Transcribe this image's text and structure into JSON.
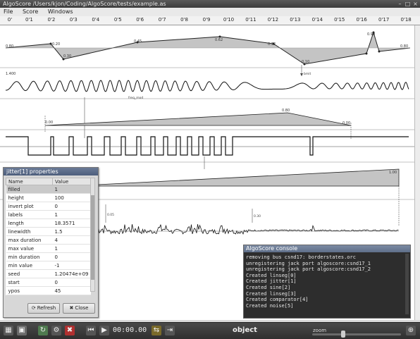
{
  "window": {
    "title": "AlgoScore /Users/kjon/Coding/AlgoScore/tests/example.as"
  },
  "menu": [
    "File",
    "Score",
    "Windows"
  ],
  "ruler": [
    "0'",
    "0'1",
    "0'2",
    "0'3",
    "0'4",
    "0'5",
    "0'6",
    "0'7",
    "0'8",
    "0'9",
    "0'10",
    "0'11",
    "0'12",
    "0'13",
    "0'14",
    "0'15",
    "0'16",
    "0'17",
    "0'18"
  ],
  "score": {
    "linseg_labels": [
      "0.80",
      "0.20",
      "0.30",
      "0.45",
      "0.62",
      "0.32",
      "0.10",
      "0.90",
      "0.80"
    ],
    "sine_label": "1.400",
    "freq_note": "freq_mod",
    "marker_label": "bmit",
    "linseg2_labels": [
      "0.00",
      "0.80",
      "0.00"
    ],
    "linseg3_label": "1.00",
    "noise_labels": [
      "0.05",
      "0.30"
    ]
  },
  "properties": {
    "title": "jitter[1] properties",
    "columns": [
      "Name",
      "Value"
    ],
    "rows": [
      [
        "filled",
        "1"
      ],
      [
        "height",
        "100"
      ],
      [
        "invert plot",
        "0"
      ],
      [
        "labels",
        "1"
      ],
      [
        "length",
        "18.3571"
      ],
      [
        "linewidth",
        "1.5"
      ],
      [
        "max duration",
        "4"
      ],
      [
        "max value",
        "1"
      ],
      [
        "min duration",
        "0"
      ],
      [
        "min value",
        "-1"
      ],
      [
        "seed",
        "1.20474e+09"
      ],
      [
        "start",
        "0"
      ],
      [
        "ypos",
        "45"
      ]
    ],
    "refresh": "Refresh",
    "close": "Close"
  },
  "console": {
    "title": "AlgoScore console",
    "lines": [
      "removing bus csnd17: borderstates.orc",
      "unregistering jack port algoscore:csnd17_1",
      "unregistering jack port algoscore:csnd17_2",
      "Created linseg[0]",
      "Created jitter[1]",
      "Created sine[2]",
      "Created linseg[3]",
      "Created comparator[4]",
      "Created noise[5]"
    ]
  },
  "toolbar": {
    "time": "00:00.00",
    "mode": "object",
    "zoom_label": "zoom"
  },
  "colors": {
    "area": "#c4c4c4",
    "title": "#4a4a4a",
    "console_bg": "#2d2d2d"
  }
}
